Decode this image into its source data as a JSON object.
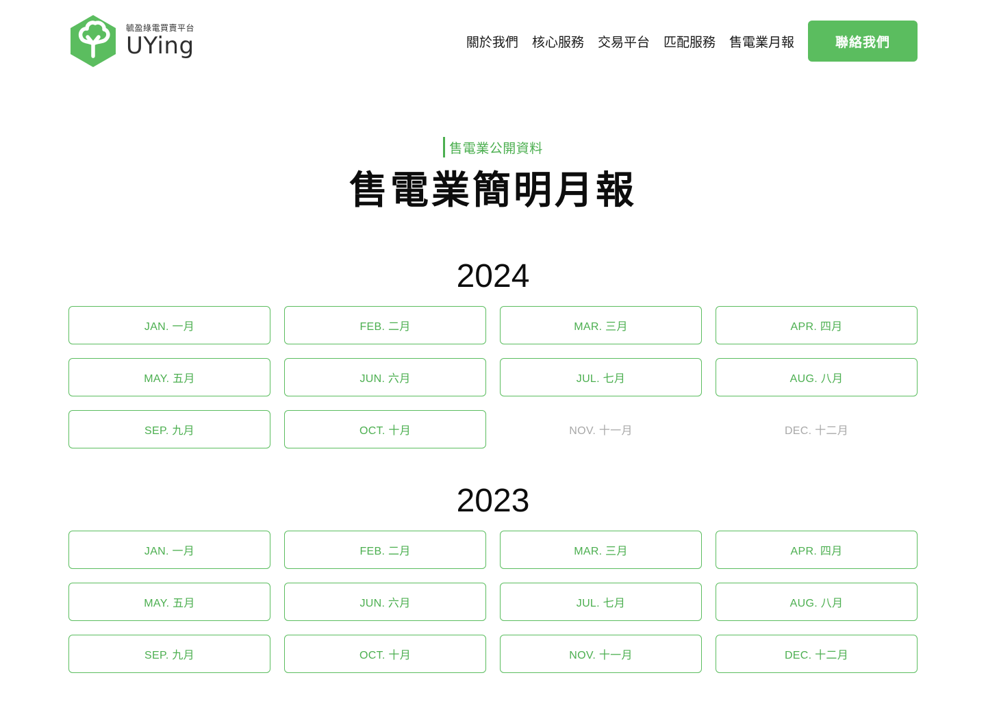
{
  "brand": {
    "subtitle": "毓盈綠電買賣平台",
    "name": "UYing",
    "color": "#5bbd5f"
  },
  "nav": {
    "items": [
      {
        "label": "關於我們"
      },
      {
        "label": "核心服務"
      },
      {
        "label": "交易平台"
      },
      {
        "label": "匹配服務"
      },
      {
        "label": "售電業月報"
      }
    ],
    "contact_label": "聯絡我們"
  },
  "hero": {
    "eyebrow": "售電業公開資料",
    "title": "售電業簡明月報"
  },
  "years": [
    {
      "year": "2024",
      "months": [
        {
          "label": "JAN. 一月",
          "available": true
        },
        {
          "label": "FEB. 二月",
          "available": true
        },
        {
          "label": "MAR. 三月",
          "available": true
        },
        {
          "label": "APR. 四月",
          "available": true
        },
        {
          "label": "MAY. 五月",
          "available": true
        },
        {
          "label": "JUN. 六月",
          "available": true
        },
        {
          "label": "JUL. 七月",
          "available": true
        },
        {
          "label": "AUG. 八月",
          "available": true
        },
        {
          "label": "SEP. 九月",
          "available": true
        },
        {
          "label": "OCT. 十月",
          "available": true
        },
        {
          "label": "NOV. 十一月",
          "available": false
        },
        {
          "label": "DEC. 十二月",
          "available": false
        }
      ]
    },
    {
      "year": "2023",
      "months": [
        {
          "label": "JAN. 一月",
          "available": true
        },
        {
          "label": "FEB. 二月",
          "available": true
        },
        {
          "label": "MAR. 三月",
          "available": true
        },
        {
          "label": "APR. 四月",
          "available": true
        },
        {
          "label": "MAY. 五月",
          "available": true
        },
        {
          "label": "JUN. 六月",
          "available": true
        },
        {
          "label": "JUL. 七月",
          "available": true
        },
        {
          "label": "AUG. 八月",
          "available": true
        },
        {
          "label": "SEP. 九月",
          "available": true
        },
        {
          "label": "OCT. 十月",
          "available": true
        },
        {
          "label": "NOV. 十一月",
          "available": true
        },
        {
          "label": "DEC. 十二月",
          "available": true
        }
      ]
    }
  ]
}
